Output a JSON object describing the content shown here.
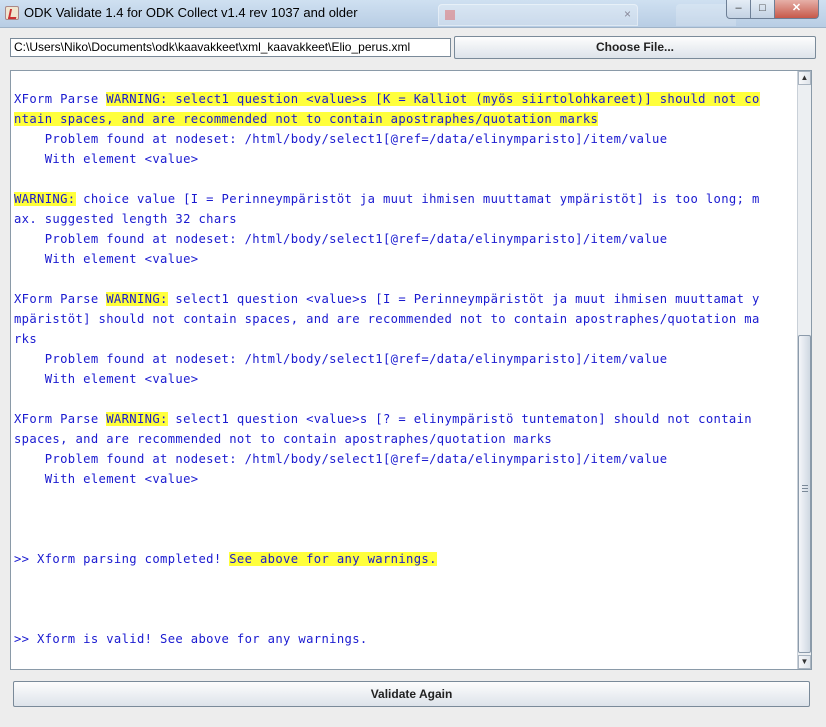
{
  "window": {
    "title": "ODK Validate 1.4 for ODK Collect v1.4 rev 1037 and older",
    "controls": {
      "minimize": "–",
      "maximize": "□",
      "close": "✕"
    }
  },
  "file": {
    "path": "C:\\Users\\Niko\\Documents\\odk\\kaavakkeet\\xml_kaavakkeet\\Elio_perus.xml",
    "choose_label": "Choose File..."
  },
  "log": {
    "lines": [
      {
        "parts": [
          {
            "text": "XForm Parse "
          },
          {
            "text": "WARNING: select1 question <value>s [K = Kalliot (myös siirtolohkareet)] should not co",
            "hl": true
          }
        ]
      },
      {
        "parts": [
          {
            "text": "ntain spaces, and are recommended not to contain apostraphes/quotation marks",
            "hl": true
          }
        ]
      },
      {
        "parts": [
          {
            "text": "    Problem found at nodeset: /html/body/select1[@ref=/data/elinymparisto]/item/value"
          }
        ]
      },
      {
        "parts": [
          {
            "text": "    With element <value>"
          }
        ]
      },
      {
        "parts": [
          {
            "text": ""
          }
        ]
      },
      {
        "parts": [
          {
            "text": "WARNING:",
            "hl": true
          },
          {
            "text": " choice value [I = Perinneympäristöt ja muut ihmisen muuttamat ympäristöt] is too long; m"
          }
        ]
      },
      {
        "parts": [
          {
            "text": "ax. suggested length 32 chars"
          }
        ]
      },
      {
        "parts": [
          {
            "text": "    Problem found at nodeset: /html/body/select1[@ref=/data/elinymparisto]/item/value"
          }
        ]
      },
      {
        "parts": [
          {
            "text": "    With element <value>"
          }
        ]
      },
      {
        "parts": [
          {
            "text": ""
          }
        ]
      },
      {
        "parts": [
          {
            "text": "XForm Parse "
          },
          {
            "text": "WARNING:",
            "hl": true
          },
          {
            "text": " select1 question <value>s [I = Perinneympäristöt ja muut ihmisen muuttamat y"
          }
        ]
      },
      {
        "parts": [
          {
            "text": "mpäristöt] should not contain spaces, and are recommended not to contain apostraphes/quotation ma"
          }
        ]
      },
      {
        "parts": [
          {
            "text": "rks"
          }
        ]
      },
      {
        "parts": [
          {
            "text": "    Problem found at nodeset: /html/body/select1[@ref=/data/elinymparisto]/item/value"
          }
        ]
      },
      {
        "parts": [
          {
            "text": "    With element <value>"
          }
        ]
      },
      {
        "parts": [
          {
            "text": ""
          }
        ]
      },
      {
        "parts": [
          {
            "text": "XForm Parse "
          },
          {
            "text": "WARNING:",
            "hl": true
          },
          {
            "text": " select1 question <value>s [? = elinympäristö tuntematon] should not contain"
          }
        ]
      },
      {
        "parts": [
          {
            "text": "spaces, and are recommended not to contain apostraphes/quotation marks"
          }
        ]
      },
      {
        "parts": [
          {
            "text": "    Problem found at nodeset: /html/body/select1[@ref=/data/elinymparisto]/item/value"
          }
        ]
      },
      {
        "parts": [
          {
            "text": "    With element <value>"
          }
        ]
      },
      {
        "parts": [
          {
            "text": ""
          }
        ]
      },
      {
        "parts": [
          {
            "text": ""
          }
        ]
      },
      {
        "parts": [
          {
            "text": ""
          }
        ]
      },
      {
        "parts": [
          {
            "text": ">> Xform parsing completed! "
          },
          {
            "text": "See above for any warnings.",
            "hl": true
          }
        ]
      },
      {
        "parts": [
          {
            "text": ""
          }
        ]
      },
      {
        "parts": [
          {
            "text": ""
          }
        ]
      },
      {
        "parts": [
          {
            "text": ""
          }
        ]
      },
      {
        "parts": [
          {
            "text": ">> Xform is valid! See above for any warnings."
          }
        ]
      }
    ]
  },
  "validate_label": "Validate Again",
  "colors": {
    "log_text": "#1a1ad0",
    "highlight": "#ffff3c",
    "annotation_underline": "#e01010"
  },
  "icons": {
    "app": "java-app-icon",
    "scroll_up": "arrow-up-icon",
    "scroll_down": "arrow-down-icon"
  }
}
